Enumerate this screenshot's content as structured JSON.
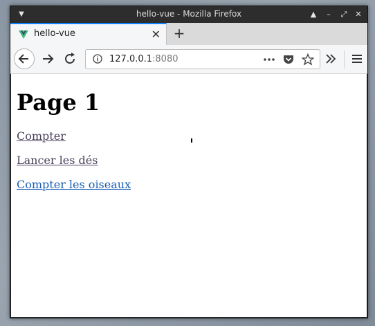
{
  "window": {
    "title": "hello-vue - Mozilla Firefox"
  },
  "tab": {
    "title": "hello-vue"
  },
  "address": {
    "host": "127.0.0.1",
    "port": ":8080"
  },
  "page": {
    "heading": "Page 1",
    "links": [
      {
        "label": "Compter"
      },
      {
        "label": "Lancer les dés"
      },
      {
        "label": "Compter les oiseaux"
      }
    ]
  },
  "colors": {
    "accent": "#0a84ff",
    "visited_link": "#4a3f5a",
    "link": "#1a5fb4"
  },
  "icons": [
    "menu-icon",
    "minimize-icon",
    "restore-icon",
    "maximize-icon",
    "close-icon",
    "vue-favicon-icon",
    "tab-close-icon",
    "new-tab-icon",
    "back-icon",
    "forward-icon",
    "reload-icon",
    "info-icon",
    "page-actions-icon",
    "pocket-icon",
    "bookmark-star-icon",
    "overflow-icon",
    "hamburger-menu-icon"
  ]
}
